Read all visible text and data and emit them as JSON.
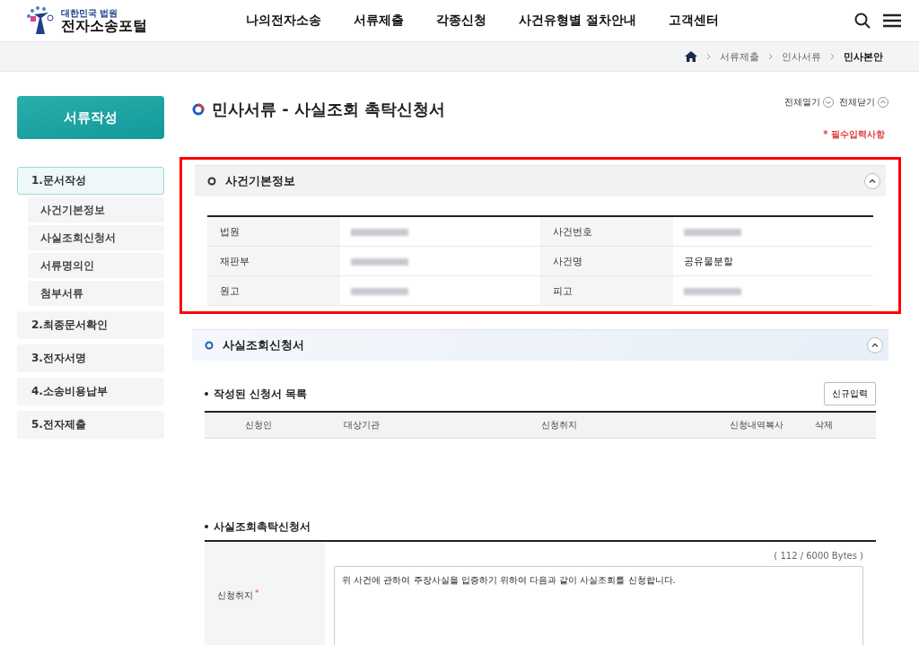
{
  "logo": {
    "top": "대한민국 법원",
    "bottom": "전자소송포털"
  },
  "nav": [
    "나의전자소송",
    "서류제출",
    "각종신청",
    "사건유형별 절차안내",
    "고객센터"
  ],
  "breadcrumb": [
    {
      "label": "서류제출",
      "current": false
    },
    {
      "label": "인사서류",
      "current": false
    },
    {
      "label": "민사본안",
      "current": true
    }
  ],
  "sidebar": {
    "title": "서류작성",
    "items": [
      {
        "label": "1.문서작성",
        "selected": true,
        "children": [
          {
            "label": "사건기본정보"
          },
          {
            "label": "사실조회신청서"
          },
          {
            "label": "서류명의인"
          },
          {
            "label": "첨부서류"
          }
        ]
      },
      {
        "label": "2.최종문서확인",
        "selected": false
      },
      {
        "label": "3.전자서명",
        "selected": false
      },
      {
        "label": "4.소송비용납부",
        "selected": false
      },
      {
        "label": "5.전자제출",
        "selected": false
      }
    ]
  },
  "page_title": "민사서류 - 사실조회 촉탁신청서",
  "expand_all": "전체열기",
  "collapse_all": "전체닫기",
  "required_note": "* 필수입력사항",
  "case_section": {
    "title": "사건기본정보",
    "highlighted": true,
    "expanded": true,
    "rows": [
      [
        {
          "label": "법원",
          "redacted": true
        },
        {
          "label": "사건번호",
          "redacted": true
        }
      ],
      [
        {
          "label": "재판부",
          "redacted": true
        },
        {
          "label": "사건명",
          "value": "공유물분할"
        }
      ],
      [
        {
          "label": "원고",
          "redacted": true
        },
        {
          "label": "피고",
          "redacted": true
        }
      ]
    ]
  },
  "request_section": {
    "title": "사실조회신청서",
    "expanded": true,
    "list_title": "작성된 신청서 목록",
    "new_button": "신규입력",
    "columns": [
      "신청인",
      "대상기관",
      "신청취지",
      "신청내역복사",
      "삭제"
    ],
    "form_title": "사실조회촉탁신청서",
    "field_label": "신청취지",
    "required_mark": "*",
    "byte_count": "( 112 / 6000 Bytes )",
    "field_value": "위 사건에 관하여 주장사실을 입증하기 위하여 다음과 같이 사실조회를 신청합니다."
  }
}
